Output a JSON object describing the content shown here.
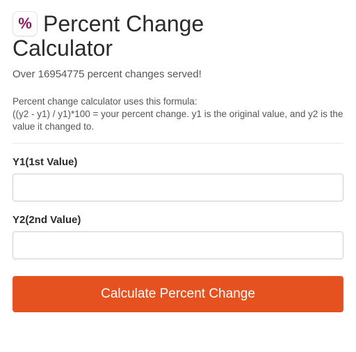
{
  "header": {
    "icon_glyph": "%",
    "title_line1": "Percent Change",
    "title_line2": "Calculator",
    "served_text": "Over 16954775 percent changes served!"
  },
  "formula": {
    "intro": "Percent change calculator uses this formula:",
    "body": "((y2 - y1) / y1)*100 = your percent change. y1 is the original value, and y2 is the value it changed to."
  },
  "form": {
    "y1_label": "Y1(1st Value)",
    "y1_value": "",
    "y2_label": "Y2(2nd Value)",
    "y2_value": "",
    "submit_label": "Calculate Percent Change"
  }
}
